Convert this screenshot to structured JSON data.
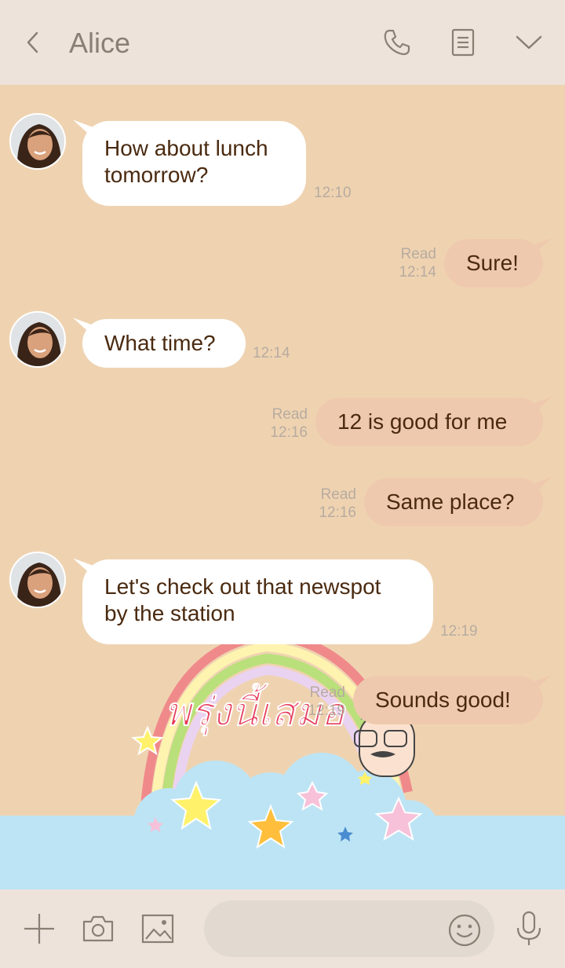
{
  "header": {
    "title": "Alice",
    "icons": [
      "chevron-left-icon",
      "phone-icon",
      "notes-icon",
      "chevron-down-icon"
    ]
  },
  "messages": [
    {
      "side": "in",
      "lines": [
        "How about lunch",
        "tomorrow?"
      ],
      "time": "12:10"
    },
    {
      "side": "out",
      "lines": [
        "Sure!"
      ],
      "read": "Read",
      "time": "12:14"
    },
    {
      "side": "in",
      "lines": [
        "What time?"
      ],
      "time": "12:14"
    },
    {
      "side": "out",
      "lines": [
        "12 is good for me"
      ],
      "read": "Read",
      "time": "12:16"
    },
    {
      "side": "out",
      "lines": [
        "Same place?"
      ],
      "read": "Read",
      "time": "12:16"
    },
    {
      "side": "in",
      "lines": [
        "Let's check out that newspot",
        "by the station"
      ],
      "time": "12:19"
    },
    {
      "side": "out",
      "lines": [
        "Sounds good!"
      ],
      "read": "Read",
      "time": "12:19"
    }
  ],
  "background_art": {
    "text_line1": "พรุ่งนี้เสมอ"
  },
  "input_bar": {
    "placeholder": "",
    "icons": [
      "plus-icon",
      "camera-icon",
      "image-icon",
      "emoji-icon",
      "microphone-icon"
    ]
  },
  "colors": {
    "header_bg": "#ede3db",
    "chat_bg": "#efd3b1",
    "incoming_bubble": "#ffffff",
    "outgoing_bubble": "#efc9ad",
    "message_text": "#4a2a10",
    "meta_text": "#b8aba0",
    "cloud_blue": "#bde4f4"
  }
}
